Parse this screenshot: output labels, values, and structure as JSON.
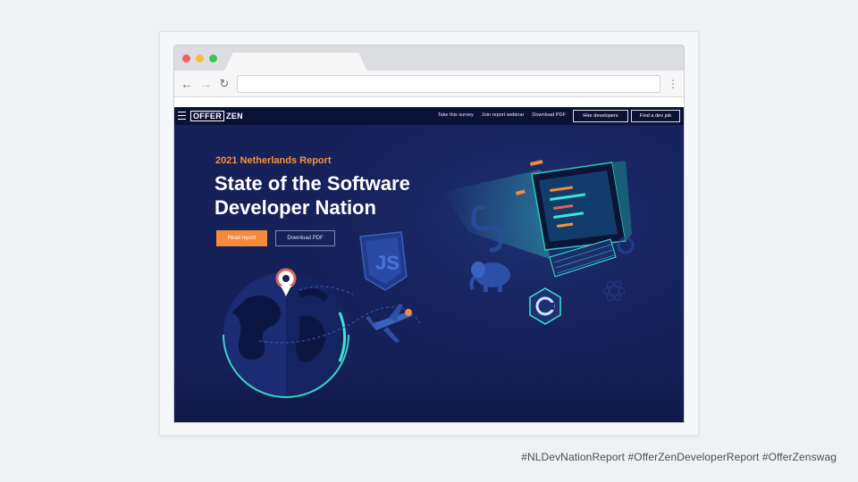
{
  "site": {
    "logo_boxed": "OFFER",
    "logo_plain": "ZEN",
    "nav_links": [
      "Take this survey",
      "Join report webinar",
      "Download PDF"
    ],
    "hire_button": "Hire developers",
    "find_button": "Find a dev job",
    "eyebrow": "2021 Netherlands Report",
    "title_line1": "State of the Software",
    "title_line2": "Developer Nation",
    "read_button": "Read report",
    "download_button": "Download PDF"
  },
  "browser": {
    "address_value": "",
    "back_icon": "arrow-left-icon",
    "forward_icon": "arrow-right-icon",
    "reload_icon": "reload-icon",
    "menu_icon": "vertical-dots-icon"
  },
  "footer": {
    "hashtags": "#NLDevNationReport #OfferZenDeveloperReport #OfferZenswag"
  },
  "colors": {
    "hero_bg": "#16215a",
    "nav_bg": "#0c1236",
    "accent_orange": "#f6893a",
    "teal": "#3ee6d2"
  }
}
